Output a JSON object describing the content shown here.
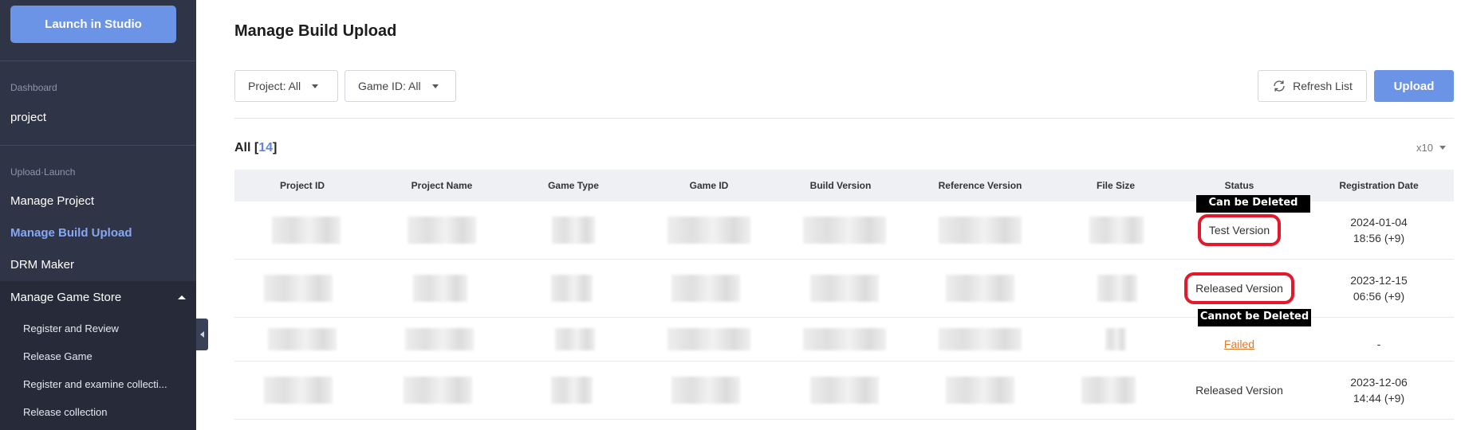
{
  "sidebar": {
    "launch_label": "Launch in Studio",
    "sections": {
      "dashboard": "Dashboard",
      "upload_launch": "Upload·Launch"
    },
    "project_label": "project",
    "items": [
      {
        "label": "Manage Project",
        "active": false
      },
      {
        "label": "Manage Build Upload",
        "active": true
      },
      {
        "label": "DRM Maker",
        "active": false
      }
    ],
    "store_group": {
      "label": "Manage Game Store",
      "expanded": true,
      "sub_items": [
        "Register and Review",
        "Release Game",
        "Register and examine collecti...",
        "Release collection"
      ]
    },
    "icons": {
      "collapse": "chevron-left-icon"
    }
  },
  "page": {
    "title": "Manage Build Upload"
  },
  "filters": {
    "project": "Project: All",
    "game_id": "Game ID: All"
  },
  "toolbar": {
    "refresh_label": "Refresh List",
    "upload_label": "Upload"
  },
  "list": {
    "all_prefix": "All [",
    "count": "14",
    "all_suffix": "]",
    "per_page": "x10"
  },
  "table": {
    "columns": [
      "Project ID",
      "Project Name",
      "Game Type",
      "Game ID",
      "Build Version",
      "Reference Version",
      "File Size",
      "Status",
      "Registration Date"
    ],
    "rows": [
      {
        "status": "Test Version",
        "status_style": "highlighted",
        "date_line1": "2024-01-04",
        "date_line2": "18:56 (+9)"
      },
      {
        "status": "Released Version",
        "status_style": "highlighted",
        "date_line1": "2023-12-15",
        "date_line2": "06:56 (+9)"
      },
      {
        "status": "Failed",
        "status_style": "link",
        "date_line1": "-",
        "date_line2": ""
      },
      {
        "status": "Released Version",
        "status_style": "plain",
        "date_line1": "2023-12-06",
        "date_line2": "14:44 (+9)"
      }
    ]
  },
  "annotations": {
    "can_delete": "Can be Deleted",
    "cannot_delete": "Cannot be Deleted"
  },
  "colors": {
    "sidebar_bg": "#2f3447",
    "accent": "#6b93e6",
    "highlight_ring": "#e3182a",
    "failed": "#e07a2b"
  }
}
